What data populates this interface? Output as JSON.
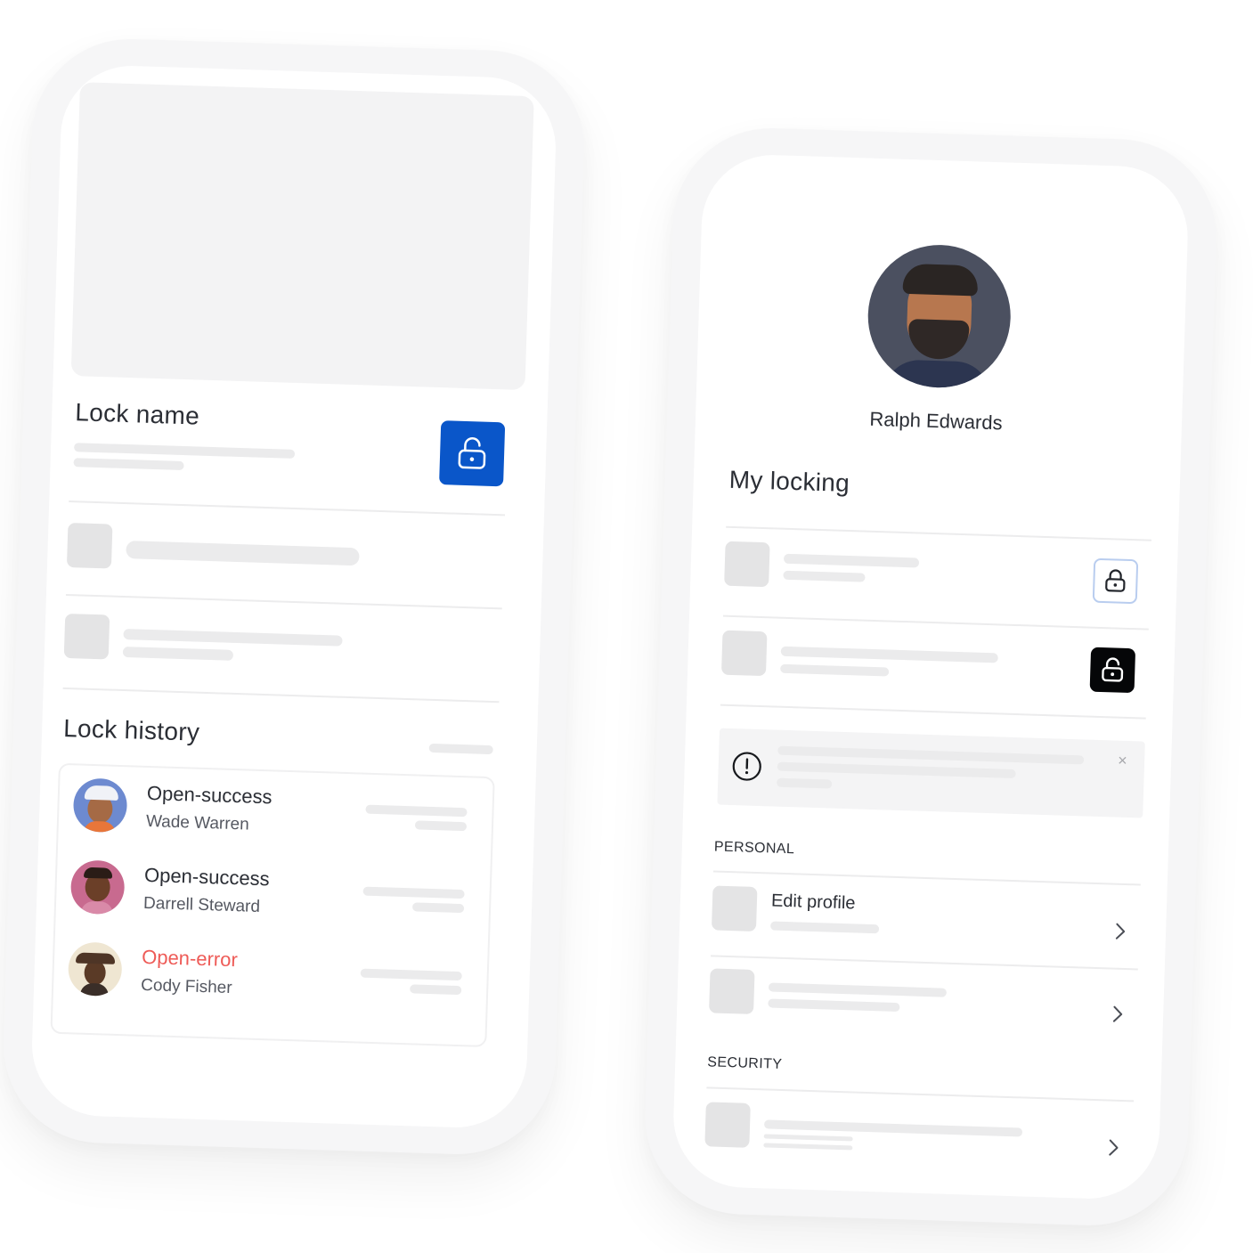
{
  "lock_screen": {
    "lock_name_label": "Lock name",
    "history_label": "Lock history",
    "history": [
      {
        "status": "Open-success",
        "user": "Wade Warren",
        "status_color": "#2b2e35",
        "avatar_bg": "#6d8ad0"
      },
      {
        "status": "Open-success",
        "user": "Darrell Steward",
        "status_color": "#2b2e35",
        "avatar_bg": "#c86a8f"
      },
      {
        "status": "Open-error",
        "user": "Cody Fisher",
        "status_color": "#ee5b57",
        "avatar_bg": "#e9dcc3"
      }
    ],
    "lock_button_icon": "padlock-icon",
    "accent": "#0a56c9"
  },
  "profile_screen": {
    "user_name": "Ralph Edwards",
    "my_locking_label": "My locking",
    "alert_icon": "alert-circle-icon",
    "alert_close": "×",
    "personal_label": "PERSONAL",
    "edit_profile_label": "Edit profile",
    "security_label": "SECURITY"
  }
}
